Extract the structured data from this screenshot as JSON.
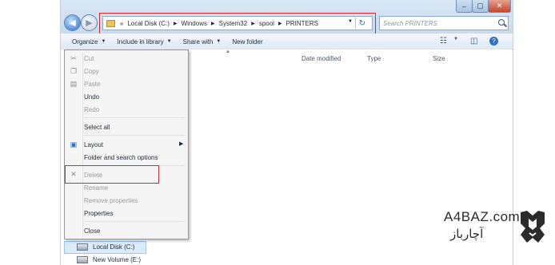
{
  "address_bar": {
    "prefix": "«",
    "crumbs": [
      "Local Disk (C:)",
      "Windows",
      "System32",
      "spool",
      "PRINTERS"
    ]
  },
  "search": {
    "placeholder": "Search PRINTERS"
  },
  "toolbar": {
    "organize": "Organize",
    "include_in_library": "Include in library",
    "share_with": "Share with",
    "new_folder": "New folder"
  },
  "columns": {
    "date_modified": "Date modified",
    "type": "Type",
    "size": "Size"
  },
  "context_menu": {
    "cut": "Cut",
    "copy": "Copy",
    "paste": "Paste",
    "undo": "Undo",
    "redo": "Redo",
    "select_all": "Select all",
    "layout": "Layout",
    "folder_search_options": "Folder and search options",
    "delete": "Delete",
    "rename": "Rename",
    "remove_properties": "Remove properties",
    "properties": "Properties",
    "close": "Close"
  },
  "nav_pane": {
    "local_disk": "Local Disk (C:)",
    "new_volume": "New Volume (E:)"
  },
  "brand": {
    "latin": "A4BAZ.com",
    "persian": "آچارباز"
  },
  "colors": {
    "highlight_border": "#d92b2b",
    "selection": "#dcebfb"
  }
}
